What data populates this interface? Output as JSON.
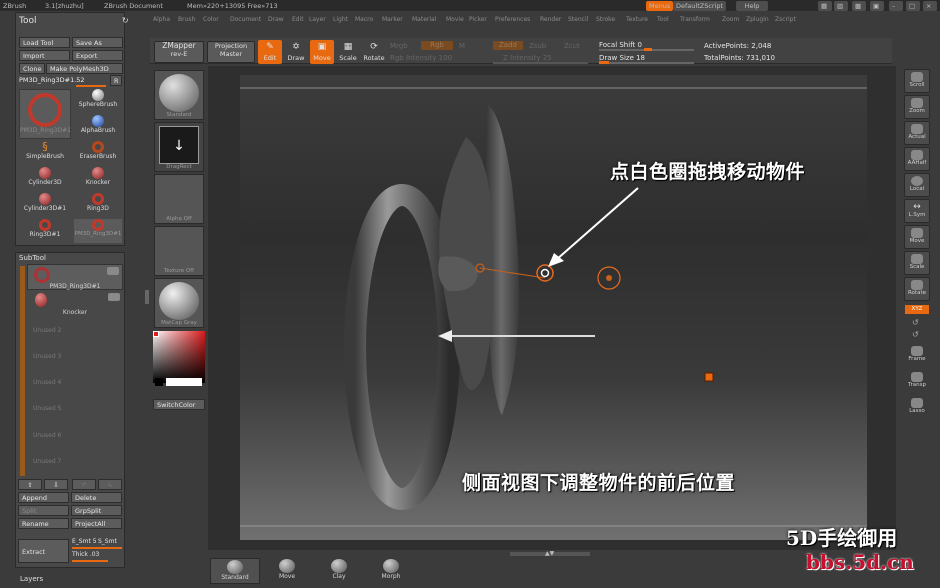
{
  "titlebar": {
    "app": "ZBrush",
    "version": "3.1[zhuzhu]",
    "document": "ZBrush Document",
    "mem": "Mem»220+13095 Free»713",
    "menus_btn": "Menus",
    "script_btn": "DefaultZScript",
    "help_btn": "Help"
  },
  "menubar": [
    "Alpha",
    "Brush",
    "Color",
    "Document",
    "Draw",
    "Edit",
    "Layer",
    "Light",
    "Macro",
    "Marker",
    "Material",
    "Movie",
    "Picker",
    "Preferences",
    "Render",
    "Stencil",
    "Stroke",
    "Texture",
    "Tool",
    "Transform",
    "Zoom",
    "Zplugin",
    "Zscript"
  ],
  "tool_panel": {
    "title": "Tool",
    "load_tool": "Load Tool",
    "save_as": "Save As",
    "import": "Import",
    "export": "Export",
    "clone": "Clone",
    "make_polymesh": "Make PolyMesh3D",
    "current_tool": "PM3D_Ring3D#1.52",
    "r_btn": "R",
    "tools": [
      {
        "label": "PM3D_Ring3D#1"
      },
      {
        "label": "SphereBrush"
      },
      {
        "label": "AlphaBrush"
      },
      {
        "label": "SimpleBrush"
      },
      {
        "label": "EraserBrush"
      },
      {
        "label": "Cylinder3D"
      },
      {
        "label": "Knocker"
      },
      {
        "label": "Cylinder3D#1"
      },
      {
        "label": "Ring3D"
      },
      {
        "label": "Ring3D#1"
      },
      {
        "label": "PM3D_Ring3D#1"
      }
    ]
  },
  "subtool_panel": {
    "title": "SubTool",
    "items": [
      "PM3D_Ring3D#1",
      "Knocker",
      "Unused 2",
      "Unused 3",
      "Unused 4",
      "Unused 5",
      "Unused 6",
      "Unused 7"
    ],
    "append": "Append",
    "delete": "Delete",
    "split": "Split",
    "grpsplit": "GrpSplit",
    "rename": "Rename",
    "projectall": "ProjectAll",
    "extract": "Extract",
    "e_smt": "E_Smt 5",
    "s_smt": "S_Smt",
    "thick": "Thick .03"
  },
  "layers_label": "Layers",
  "shelf": {
    "zmapper": "ZMapper",
    "zmapper_sub": "rev-E",
    "projection": "Projection",
    "projection_sub": "Master",
    "edit": "Edit",
    "draw": "Draw",
    "move": "Move",
    "scale": "Scale",
    "rotate": "Rotate",
    "mrgb": "Mrgb",
    "rgb": "Rgb",
    "m": "M",
    "zadd": "Zadd",
    "zsub": "Zsub",
    "zcut": "Zcut",
    "rgb_intensity": "Rgb Intensity 100",
    "z_intensity": "Z Intensity 25",
    "focal_shift": "Focal Shift 0",
    "draw_size": "Draw Size 18",
    "active_points": "ActivePoints: 2,048",
    "total_points": "TotalPoints: 731,010"
  },
  "left_shelf": {
    "standard": "Standard",
    "dragrect": "DragRect",
    "alpha_off": "Alpha Off",
    "texture_off": "Texture Off",
    "matcap": "MatCap Gray",
    "switch_color": "SwitchColor"
  },
  "right_shelf": [
    "Scroll",
    "Zoom",
    "Actual",
    "AAHalf",
    "Local",
    "L.Sym",
    "Move",
    "Scale",
    "Rotate",
    "XYZ",
    "Frame",
    "Transp",
    "Lasso"
  ],
  "bottom_shelf": [
    "Standard",
    "Move",
    "Clay",
    "Morph"
  ],
  "annotations": {
    "top": "点白色圈拖拽移动物件",
    "bottom": "侧面视图下调整物件的前后位置"
  },
  "watermark": {
    "line1": "5D手绘御用",
    "line2": "bbs.5d.cn"
  },
  "colors": {
    "accent": "#e8690f",
    "panel": "#484848",
    "background": "#3b3b3b",
    "watermark_red": "#c8102e"
  }
}
